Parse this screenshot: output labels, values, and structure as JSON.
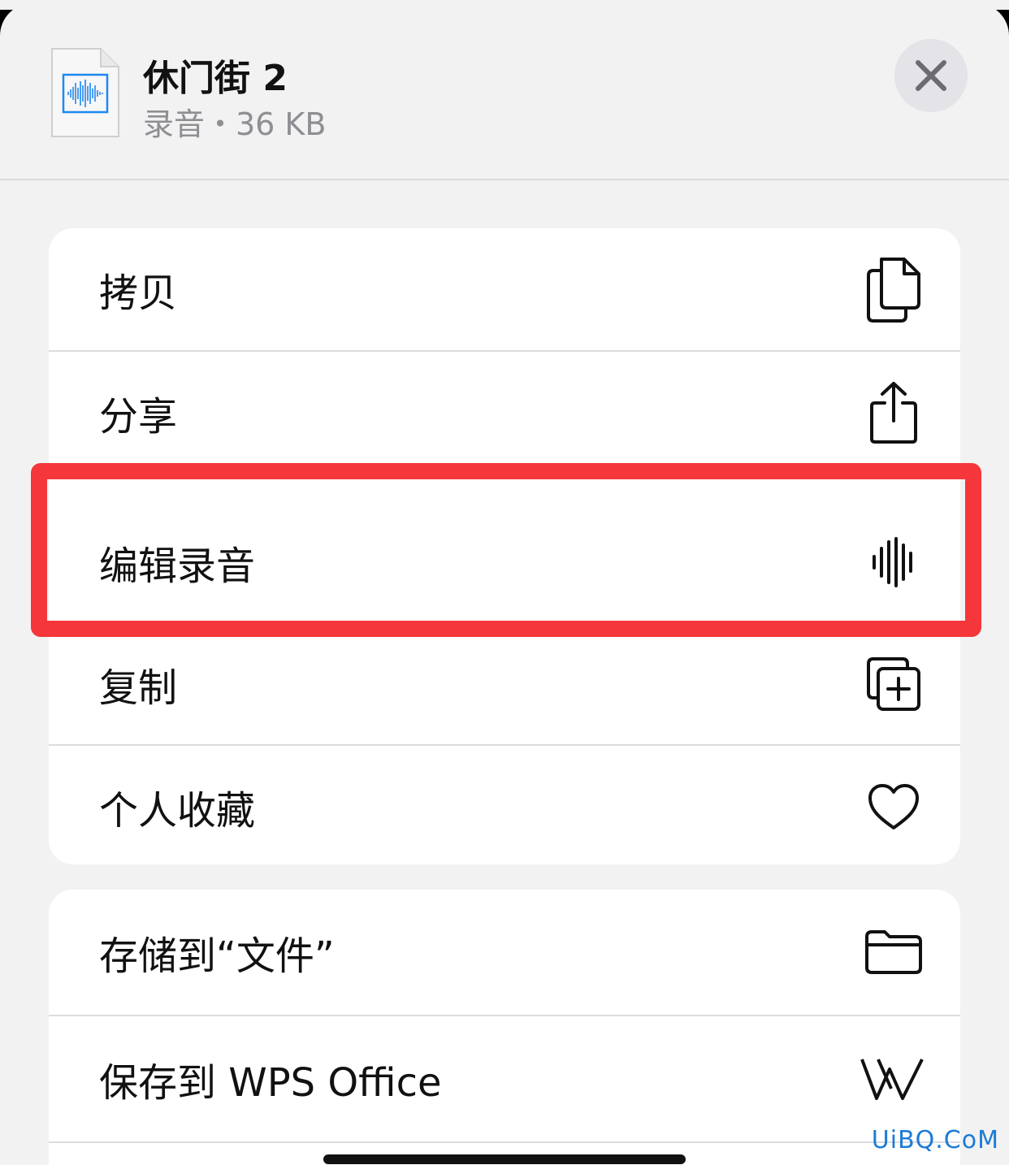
{
  "header": {
    "file_name": "休门街 2",
    "file_meta": "录音・36 KB",
    "file_icon": "audio-waveform-file-icon",
    "close_icon": "xmark-icon"
  },
  "group1": [
    {
      "label": "拷贝",
      "icon": "copy-icon"
    },
    {
      "label": "分享",
      "icon": "share-icon"
    },
    {
      "label": "编辑录音",
      "icon": "waveform-icon"
    },
    {
      "label": "复制",
      "icon": "duplicate-icon"
    },
    {
      "label": "个人收藏",
      "icon": "heart-icon"
    }
  ],
  "group2": [
    {
      "label": "存储到“文件”",
      "icon": "folder-icon"
    },
    {
      "label": "保存到 WPS Office",
      "icon": "wps-icon"
    }
  ],
  "highlight_color": "#f5363a",
  "watermark": "UiBQ.CoM"
}
